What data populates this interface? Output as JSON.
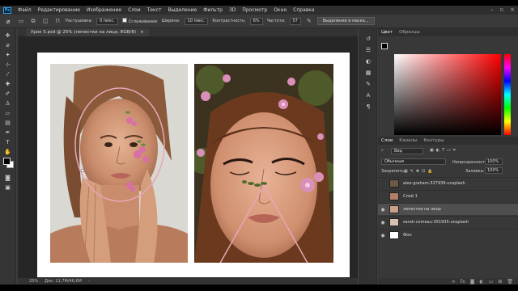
{
  "app": {
    "menu": [
      "Файл",
      "Редактирование",
      "Изображение",
      "Слои",
      "Текст",
      "Выделение",
      "Фильтр",
      "3D",
      "Просмотр",
      "Окно",
      "Справка"
    ],
    "logo": "Ps"
  },
  "options": {
    "feather_label": "Растушевка:",
    "feather_value": "0 пикс.",
    "antialias_label": "Сглаживание",
    "width_label": "Ширина:",
    "width_value": "10 пикс.",
    "contrast_label": "Контрастность:",
    "contrast_value": "6%",
    "frequency_label": "Частота:",
    "frequency_value": "57",
    "select_mask_label": "Выделение и маска..."
  },
  "document": {
    "tab_title": "Урок 5.psd @ 25% (лепестки на лице, RGB/8)",
    "tab_close": "×"
  },
  "status": {
    "zoom": "25%",
    "doc_info": "Док: 11,7M/46,6M",
    "arrow": "›"
  },
  "color_panel": {
    "tabs": [
      "Цвет",
      "Образцы"
    ]
  },
  "layers_panel": {
    "tabs": [
      "Слои",
      "Каналы",
      "Контуры"
    ],
    "kind": "Вид",
    "blend_mode": "Обычные",
    "opacity_label": "Непрозрачность:",
    "opacity_value": "100%",
    "lock_label": "Закрепить:",
    "fill_label": "Заливка:",
    "fill_value": "100%",
    "layers": [
      {
        "name": "alex-graham-327939-unsplash",
        "visible": false,
        "thumb": "#6b5a44",
        "selected": false
      },
      {
        "name": "Слой 1",
        "visible": false,
        "thumb": "#b08066",
        "selected": false
      },
      {
        "name": "лепестки на лице",
        "visible": true,
        "thumb": "#c9a08a",
        "selected": true
      },
      {
        "name": "sarah-comeau-351935-unsplash",
        "visible": true,
        "thumb": "#d8c0b0",
        "selected": false
      },
      {
        "name": "Фон",
        "visible": true,
        "thumb": "#ffffff",
        "selected": false
      }
    ],
    "footer_icons": [
      "link-icon",
      "fx-icon",
      "mask-icon",
      "adjustment-icon",
      "folder-icon",
      "new-layer-icon",
      "trash-icon"
    ]
  },
  "colors": {
    "accent_pink": "#e8a6b6",
    "selected_layer": "#4f4f4f"
  }
}
